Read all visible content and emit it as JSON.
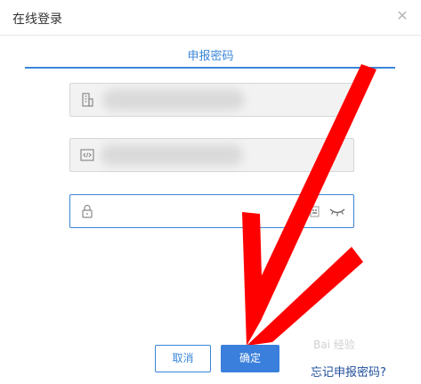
{
  "dialog": {
    "title": "在线登录",
    "close_icon": "close-icon"
  },
  "tab": {
    "label": "申报密码",
    "color": "#3a86d8"
  },
  "fields": [
    {
      "icon": "building-icon",
      "value": ""
    },
    {
      "icon": "code-icon",
      "value": ""
    },
    {
      "icon": "lock-icon",
      "placeholder": "",
      "extra_icon": "keyboard-icon",
      "toggle_icon": "eye-closed-icon"
    }
  ],
  "buttons": {
    "cancel_label": "取消",
    "confirm_label": "确定"
  },
  "links": {
    "forgot_label": "忘记申报密码?"
  },
  "watermark": {
    "text": "Bai 经验"
  },
  "annotation": {
    "arrow_color": "#ff0000"
  }
}
